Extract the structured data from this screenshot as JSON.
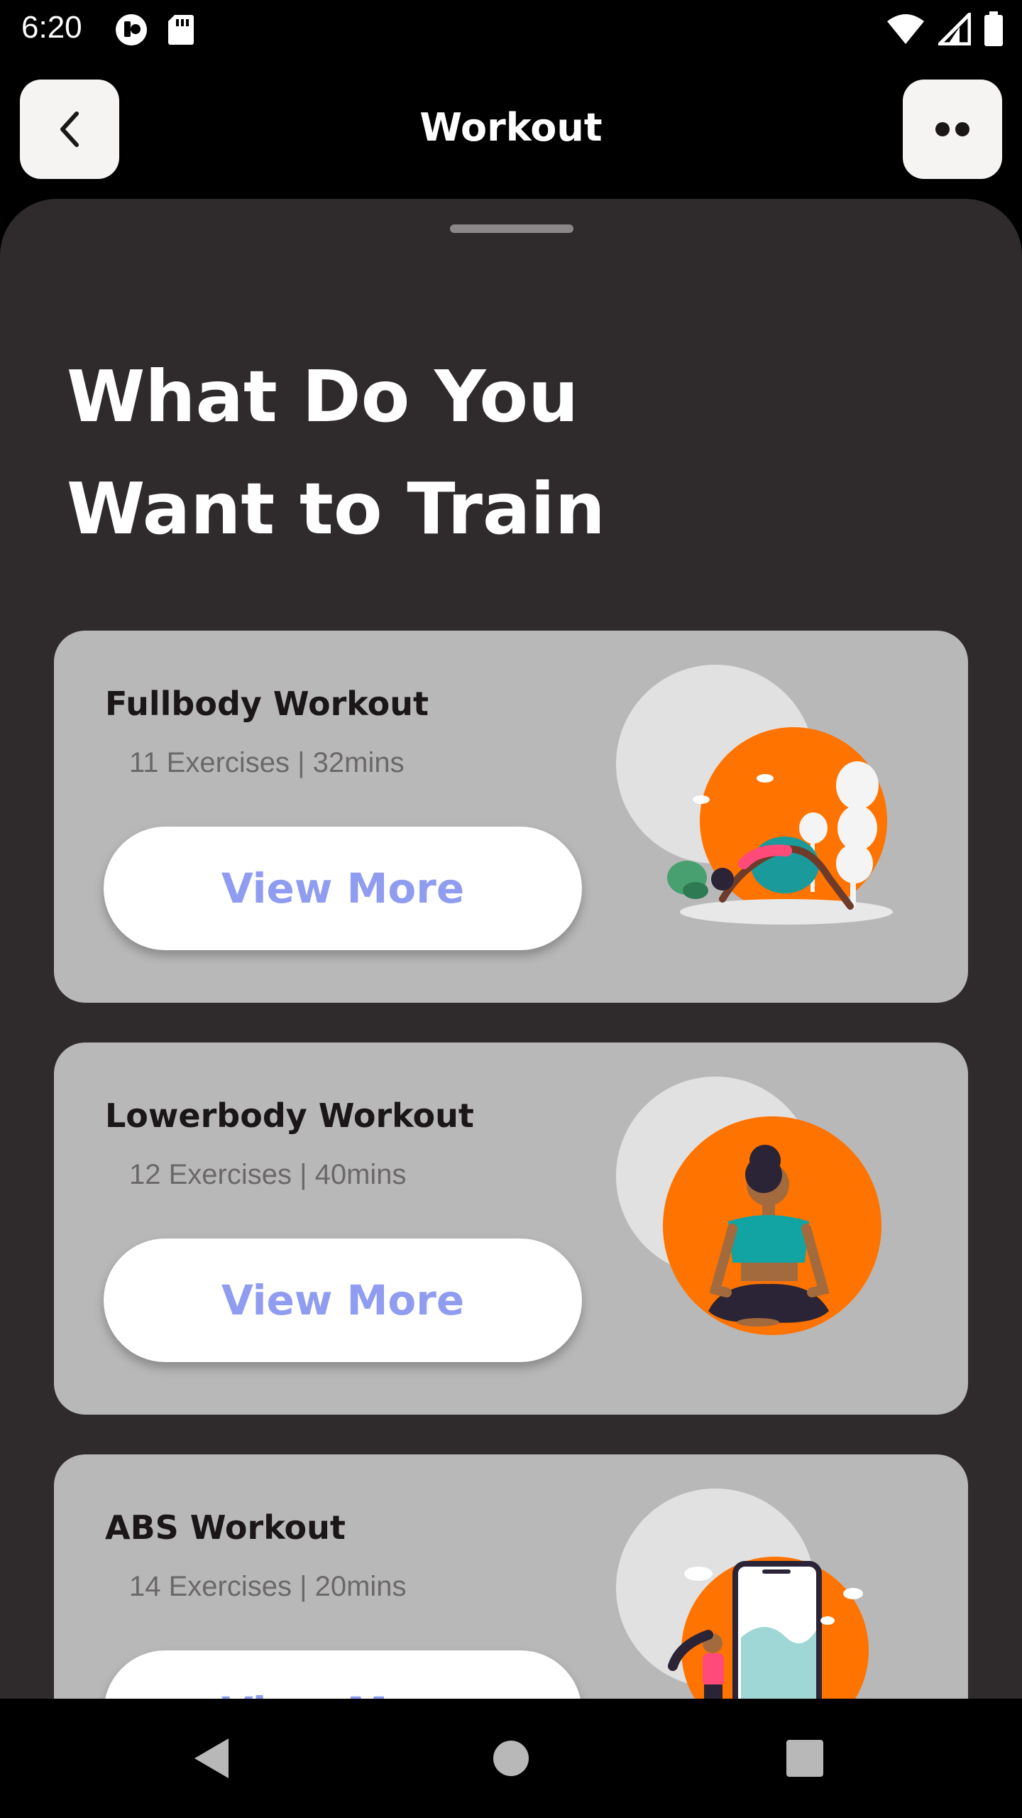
{
  "status_bar": {
    "time": "6:20"
  },
  "app_bar": {
    "title": "Workout",
    "back_icon": "chevron-left-icon",
    "more_icon": "more-dots-icon"
  },
  "page": {
    "heading_line1": "What Do You",
    "heading_line2": "Want to Train"
  },
  "workouts": [
    {
      "title": "Fullbody Workout",
      "meta": "11 Exercises | 32mins",
      "button": "View More",
      "illustration": "yoga-stretch-illustration"
    },
    {
      "title": "Lowerbody Workout",
      "meta": "12 Exercises | 40mins",
      "button": "View More",
      "illustration": "meditation-illustration"
    },
    {
      "title": "ABS Workout",
      "meta": "14 Exercises | 20mins",
      "button": "View More",
      "illustration": "phone-runner-illustration"
    }
  ],
  "colors": {
    "sheet_bg": "#2f2b2d",
    "card_bg": "#b9b8b9",
    "accent_orange": "#ff7300",
    "button_text": "#8f9cf0"
  }
}
